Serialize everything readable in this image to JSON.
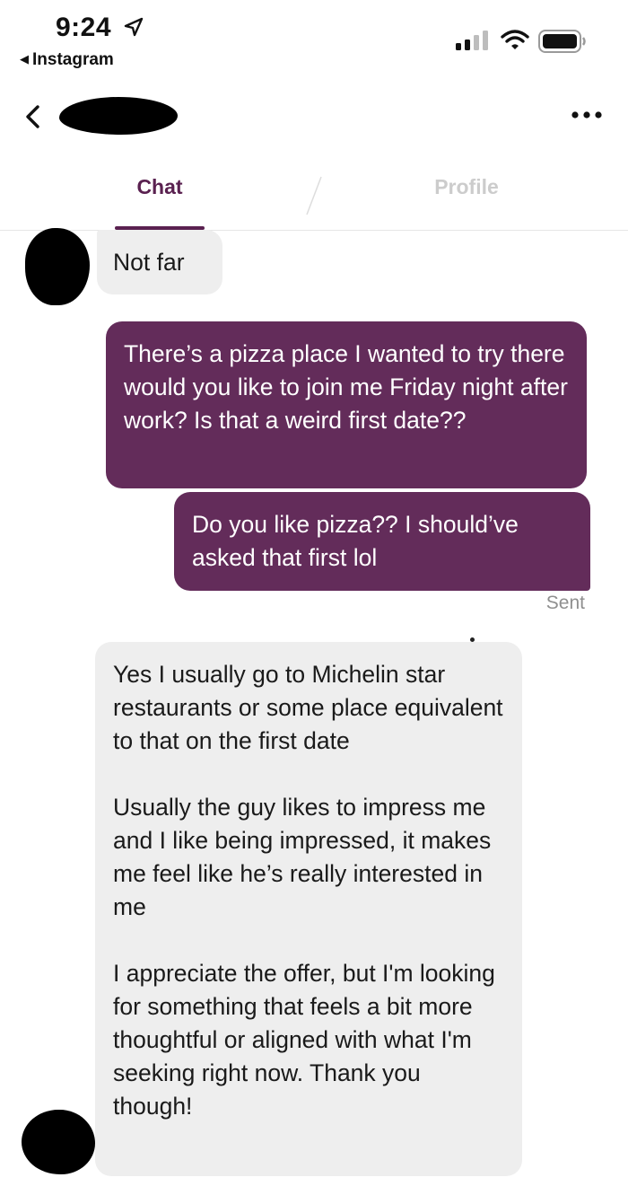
{
  "status_bar": {
    "time": "9:24",
    "back_app": "Instagram",
    "back_app_arrow": "◀",
    "icons": [
      "location-arrow-icon",
      "cellular-signal-icon",
      "wifi-icon",
      "battery-icon"
    ]
  },
  "header": {
    "back_icon": "chevron-left-icon",
    "more_icon": "more-dots-icon"
  },
  "tabs": {
    "chat": "Chat",
    "profile": "Profile",
    "active": "Chat"
  },
  "colors": {
    "accent": "#5a2150",
    "outgoing_bubble": "#632c5a",
    "incoming_bubble": "#eeeeee",
    "inactive_tab": "#cccccc"
  },
  "messages": [
    {
      "direction": "incoming",
      "text": "Not far"
    },
    {
      "direction": "outgoing",
      "text": "There’s a pizza place I wanted to try there would you like to join me Friday night after work? Is that a weird first date??"
    },
    {
      "direction": "outgoing",
      "text": "Do you like pizza?? I should’ve asked that first lol"
    },
    {
      "direction": "incoming",
      "text": "Yes I usually go to Michelin star restaurants or some place equivalent to that on the first date\n\nUsually the guy likes to impress me and I like being impressed, it makes  me feel like he’s really interested in me\n\nI appreciate the offer, but I'm looking for something that feels a bit more thoughtful or aligned with what I'm seeking right now. Thank you though!"
    }
  ],
  "receipt": "Sent"
}
